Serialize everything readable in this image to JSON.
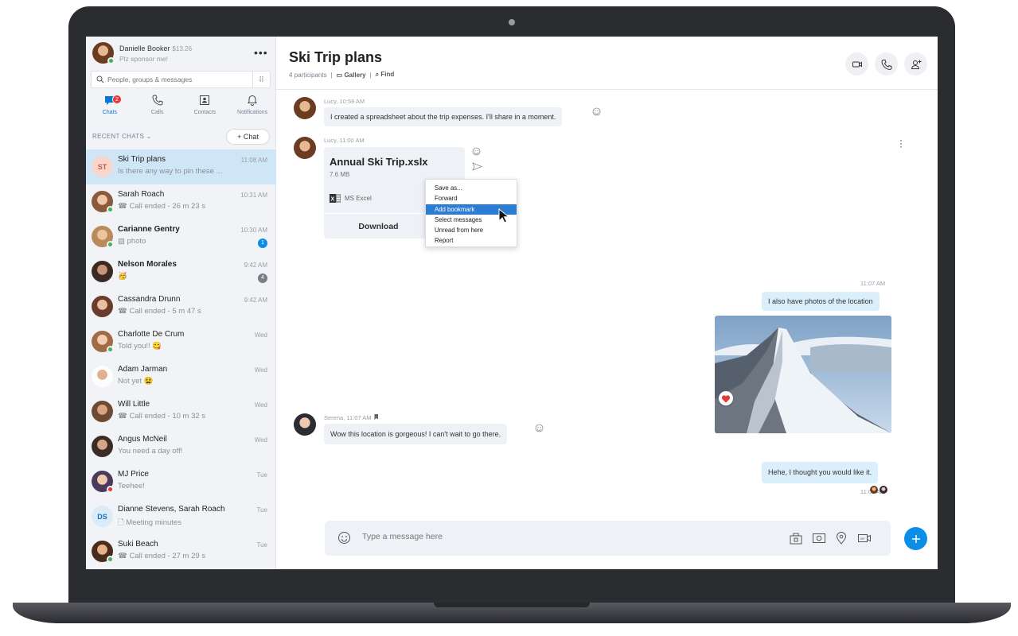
{
  "profile": {
    "name": "Danielle Booker",
    "credit": "$13.26",
    "status": "Plz sponsor me!"
  },
  "search": {
    "placeholder": "People, groups & messages"
  },
  "nav": {
    "tabs": [
      {
        "label": "Chats",
        "badge": "2"
      },
      {
        "label": "Calls"
      },
      {
        "label": "Contacts"
      },
      {
        "label": "Notifications"
      }
    ]
  },
  "recent": {
    "header": "RECENT CHATS",
    "new_chat": "+ Chat"
  },
  "chats": [
    {
      "name": "Ski Trip plans",
      "initials": "ST",
      "message": "Is there any way to pin these ...",
      "time": "11:08 AM"
    },
    {
      "name": "Sarah Roach",
      "message": "Call ended - 26 m 23 s",
      "time": "10:31 AM"
    },
    {
      "name": "Carianne Gentry",
      "message": "photo",
      "time": "10:30 AM",
      "badge": "1"
    },
    {
      "name": "Nelson Morales",
      "message": "🥳",
      "time": "9:42 AM",
      "badge": "4"
    },
    {
      "name": "Cassandra Drunn",
      "message": "Call ended - 5 m 47 s",
      "time": "9:42 AM"
    },
    {
      "name": "Charlotte De Crum",
      "message": "Told you!! 😋",
      "time": "Wed"
    },
    {
      "name": "Adam Jarman",
      "message": "Not yet 😫",
      "time": "Wed"
    },
    {
      "name": "Will Little",
      "message": "Call ended - 10 m 32 s",
      "time": "Wed"
    },
    {
      "name": "Angus McNeil",
      "message": "You need a day off!",
      "time": "Wed"
    },
    {
      "name": "MJ Price",
      "message": "Teehee!",
      "time": "Tue"
    },
    {
      "name": "Dianne Stevens, Sarah Roach",
      "initials": "DS",
      "message": "Meeting minutes",
      "time": "Tue"
    },
    {
      "name": "Suki Beach",
      "message": "Call ended - 27 m 29 s",
      "time": "Tue"
    }
  ],
  "conversation": {
    "title": "Ski Trip plans",
    "participants": "4 participants",
    "gallery": "Gallery",
    "find": "Find"
  },
  "messages": {
    "m1": {
      "meta": "Lucy, 10:59 AM",
      "text": "I created a spreadsheet about the trip expenses. I'll share in a moment."
    },
    "m2": {
      "meta": "Lucy, 11:00 AM",
      "file_name": "Annual Ski Trip.xslx",
      "file_size": "7.6 MB",
      "file_app": "MS Excel",
      "download": "Download"
    },
    "m3": {
      "meta": "11:07 AM",
      "text": "I also have photos of the location"
    },
    "m4": {
      "meta": "Serena, 11:07 AM",
      "text": "Wow this location is gorgeous! I can't wait to go there."
    },
    "m5": {
      "meta": "11:08 AM",
      "text": "Hehe, I thought you would like it."
    }
  },
  "context_menu": {
    "items": [
      "Save as...",
      "Forward",
      "Add bookmark",
      "Select messages",
      "Unread from here",
      "Report"
    ],
    "highlighted": "Add bookmark"
  },
  "composer": {
    "placeholder": "Type a message here"
  },
  "colors": {
    "accent": "#0078d4",
    "send": "#0d8ee6",
    "selected": "#cfe6f7",
    "unread_blue": "#0d8ee6",
    "unread_gray": "#7a7e86"
  }
}
